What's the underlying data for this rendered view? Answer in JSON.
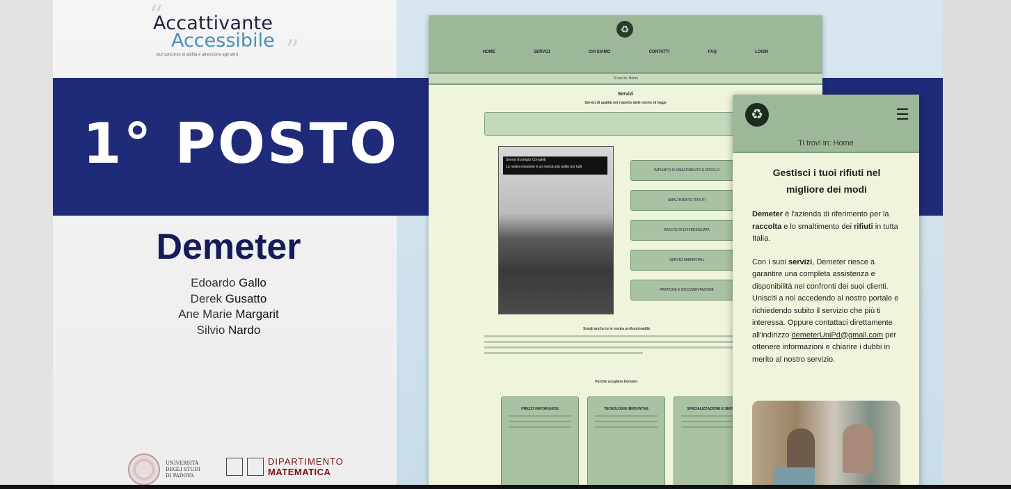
{
  "brand": {
    "line1": "Accattivante",
    "line2": "Accessibile",
    "tagline": "(sul concorso di abilità e attenzione agli altri)"
  },
  "award": {
    "rank": "1° POSTO",
    "team": "Demeter",
    "members": [
      {
        "first": "Edoardo",
        "last": "Gallo"
      },
      {
        "first": "Derek",
        "last": "Gusatto"
      },
      {
        "first": "Ane Marie",
        "last": "Margarit"
      },
      {
        "first": "Silvio",
        "last": "Nardo"
      }
    ]
  },
  "footer": {
    "university": [
      "UNIVERSITÀ",
      "DEGLI STUDI",
      "DI PADOVA"
    ],
    "dept_line1": "DIPARTIMENTO",
    "dept_line2": "MATEMATICA"
  },
  "desktop": {
    "nav": [
      "HOME",
      "SERVIZI",
      "CHI SIAMO",
      "CONTATTI",
      "FAQ",
      "LOGIN"
    ],
    "breadcrumb": "Ti trovi in: Home",
    "title": "Servizi",
    "subtitle": "Servizi di qualità nel rispetto delle norme di legge",
    "photo_caption_title": "Servizi Ecologici Completi",
    "photo_caption_sub": "La nostra missione è un mondo più pulito per tutti",
    "service_buttons": [
      "IMPIANTO DI SMALTIMENTO E RICICLO",
      "SMALTIMENTO RIFIUTI",
      "RACCOLTA DIFFERENZIATA",
      "SERVIZI AMBIENTALI",
      "PRATICHE E DOCUMENTAZIONE"
    ],
    "section1": "Scegli anche tu la nostra professionalità",
    "section2": "Perché scegliere Demeter",
    "cards": [
      "PREZZI VANTAGGIOSI",
      "TECNOLOGIE INNOVATIVE",
      "SPECIALIZZAZIONE E SERVIZI"
    ]
  },
  "mobile": {
    "breadcrumb": "Ti trovi in: Home",
    "title_line1": "Gestisci i tuoi rifiuti nel",
    "title_line2": "migliore dei modi",
    "p1_a": "Demeter",
    "p1_b": " è l'azienda di riferimento per la ",
    "p1_c": "raccolta",
    "p1_d": " e lo smaltimento dei ",
    "p1_e": "rifiuti",
    "p1_f": " in tutta Italia.",
    "p2_a": "Con i suoi ",
    "p2_b": "servizi",
    "p2_c": ", Demeter riesce a garantire una completa assistenza e disponibilità nei confronti dei suoi clienti. Unisciti a noi accedendo al nostro portale e richiedendo subito il servizio che più ti interessa. Oppure contattaci direttamente all'indirizzo ",
    "email": "demeterUniPd@gmail.com",
    "p2_d": " per ottenere informazioni e chiarire i dubbi in merito al nostro servizio."
  }
}
